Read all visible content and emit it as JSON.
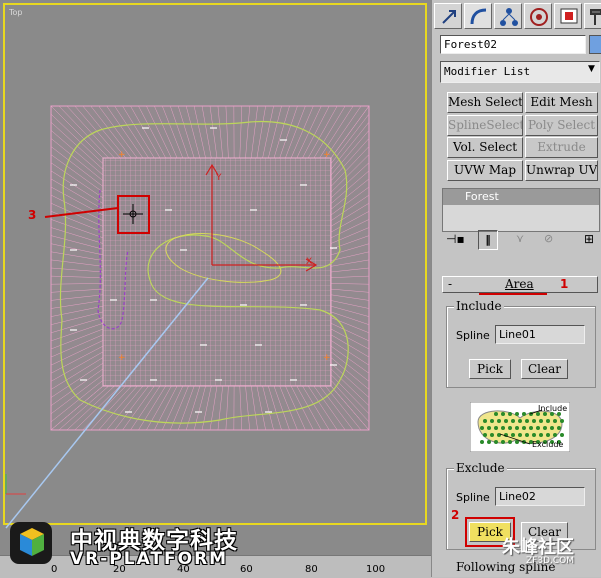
{
  "viewport": {
    "label": "Top",
    "ruler_ticks": [
      "0",
      "20",
      "40",
      "60",
      "80",
      "100"
    ]
  },
  "watermark": {
    "title": "中视典数字科技",
    "subtitle": "VR-PLATFORM",
    "corner": "朱峰社区",
    "corner_url": "ZF3D.COM"
  },
  "annotations": {
    "n1": "1",
    "n2": "2",
    "n3": "3"
  },
  "panel": {
    "object_name": "Forest02",
    "modifier_list": "Modifier List",
    "modifier_buttons": [
      {
        "label": "Mesh Select",
        "enabled": true
      },
      {
        "label": "Edit Mesh",
        "enabled": true
      },
      {
        "label": "SplineSelect",
        "enabled": false
      },
      {
        "label": "Poly Select",
        "enabled": false
      },
      {
        "label": "Vol. Select",
        "enabled": true
      },
      {
        "label": "Extrude",
        "enabled": false
      },
      {
        "label": "UVW Map",
        "enabled": true
      },
      {
        "label": "Unwrap UVW",
        "enabled": true
      }
    ],
    "stack_item": "Forest",
    "rollout_title": "Area",
    "include": {
      "title": "Include",
      "spline_label": "Spline",
      "spline_value": "Line01",
      "pick": "Pick",
      "clear": "Clear"
    },
    "diagram": {
      "include_label": "Include",
      "exclude_label": "Exclude"
    },
    "exclude": {
      "title": "Exclude",
      "spline_label": "Spline",
      "spline_value": "Line02",
      "pick": "Pick",
      "clear": "Clear"
    },
    "following": "Following spline"
  },
  "colors": {
    "grid": "#e8a0c8",
    "viewport_bg": "#8a8a8a",
    "highlight": "#d00000",
    "frame": "#e8d820"
  }
}
